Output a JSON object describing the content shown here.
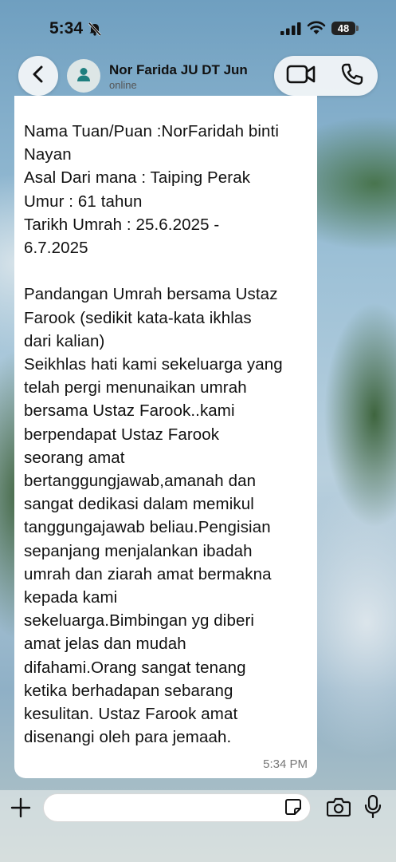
{
  "status_bar": {
    "time": "5:34",
    "battery": "48",
    "icons": [
      "bell-slash-icon",
      "cellular-signal-icon",
      "wifi-icon",
      "battery-icon"
    ]
  },
  "header": {
    "contact_name": "Nor Farida JU DT Jun",
    "contact_status": "online",
    "icons": [
      "chevron-left-icon",
      "person-avatar-icon",
      "video-camera-icon",
      "phone-icon"
    ]
  },
  "message": {
    "text": "Nama Tuan/Puan :NorFaridah binti\nNayan\nAsal Dari mana : Taiping Perak\nUmur : 61 tahun\nTarikh Umrah : 25.6.2025 -\n6.7.2025\n\nPandangan Umrah bersama Ustaz\nFarook (sedikit kata-kata ikhlas\ndari kalian)\nSeikhlas hati kami sekeluarga yang\ntelah pergi menunaikan umrah\nbersama Ustaz Farook..kami\nberpendapat Ustaz Farook\nseorang amat\nbertanggungjawab,amanah dan\nsangat dedikasi dalam memikul\ntanggungajawab beliau.Pengisian\nsepanjang menjalankan ibadah\numrah dan ziarah amat bermakna\nkepada kami\nsekeluarga.Bimbingan yg diberi\namat jelas dan mudah\ndifahami.Orang sangat tenang\nketika berhadapan sebarang\nkesulitan. Ustaz Farook amat\ndisenangi oleh para jemaah.",
    "time": "5:34 PM"
  },
  "composer": {
    "placeholder": "",
    "icons": [
      "plus-icon",
      "sticker-icon",
      "camera-icon",
      "microphone-icon"
    ]
  }
}
